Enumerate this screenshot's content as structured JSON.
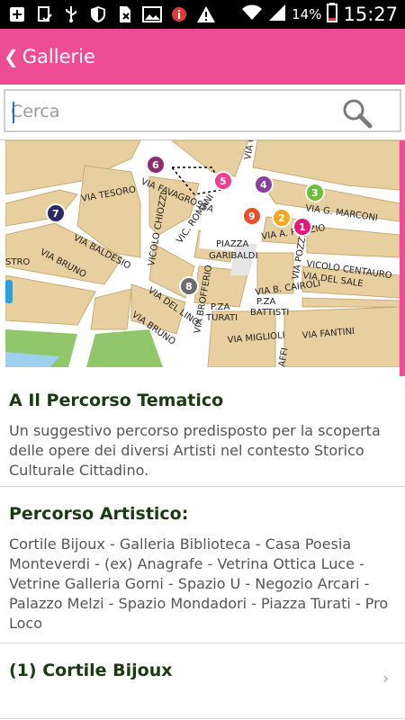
{
  "status_bar": {
    "battery_percent": "14%",
    "time": "15:27"
  },
  "header": {
    "title": "Gallerie",
    "back_icon": "chevron-left-icon"
  },
  "search": {
    "placeholder": "Cerca",
    "value": "",
    "icon": "search-icon"
  },
  "map": {
    "streets": [
      "VIA C",
      "VIA TESORO",
      "VIA FAVAGROSSA",
      "VICOLO CHIOZZI",
      "VIC. ROMANI",
      "VIA G. MARCONI",
      "VIA A. PORZIO",
      "PIAZZA",
      "GARIBALDI",
      "VIA BALDESIO",
      "VIA POZZI",
      "VICOLO CENTAURO",
      "VIA DEL SALE",
      "STRO",
      "VIA BRUNO",
      "VIA B. CAIROLI",
      "VIA DEL LINO",
      "VIA BROFFERIO",
      "P.ZA",
      "TURATI",
      "P.ZA",
      "BATTISTI",
      "VIA BRUNO",
      "VIA MIGLIOLI",
      "VIA FANTINI",
      "AFFI"
    ],
    "markers": [
      {
        "label": "1",
        "color": "#e6177c"
      },
      {
        "label": "2",
        "color": "#f5a623"
      },
      {
        "label": "3",
        "color": "#6cbf3a"
      },
      {
        "label": "4",
        "color": "#8a3fa0"
      },
      {
        "label": "5",
        "color": "#ee3f93"
      },
      {
        "label": "6",
        "color": "#8e2d6e"
      },
      {
        "label": "7",
        "color": "#2c2a64"
      },
      {
        "label": "8",
        "color": "#6b6b6b"
      },
      {
        "label": "9",
        "color": "#e8502a"
      }
    ]
  },
  "section1": {
    "title": "A Il Percorso Tematico",
    "description": "Un suggestivo percorso predisposto per la scoperta delle opere dei diversi Artisti nel contesto Storico Culturale Cittadino."
  },
  "section2": {
    "title": "Percorso Artistico:",
    "list": "Cortile Bijoux - Galleria Biblioteca - Casa Poesia Monteverdi - (ex) Anagrafe - Vetrina Ottica Luce - Vetrine Galleria Gorni - Spazio U - Negozio Arcari - Palazzo Melzi - Spazio Mondadori - Piazza Turati - Pro Loco"
  },
  "first_item": {
    "title": "(1)  Cortile Bijoux",
    "chevron": "›"
  },
  "colors": {
    "accent": "#ee4d96",
    "heading": "#1a3a12",
    "map_block": "#e8cfa0",
    "map_road": "#ffffff",
    "map_green": "#8fc76a",
    "map_water": "#9ed0ee"
  }
}
